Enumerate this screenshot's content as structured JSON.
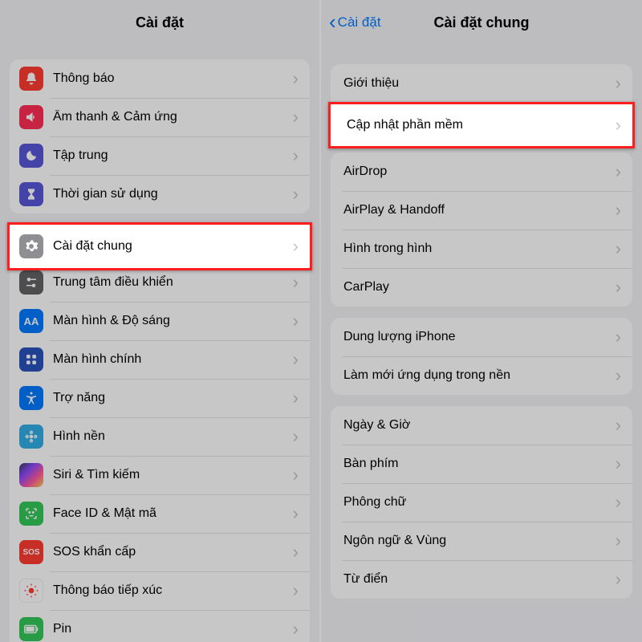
{
  "left": {
    "title": "Cài đặt",
    "groups": [
      [
        {
          "icon": "bell",
          "bg": "bg-red",
          "label": "Thông báo"
        },
        {
          "icon": "speaker",
          "bg": "bg-pink",
          "label": "Âm thanh & Cảm ứng"
        },
        {
          "icon": "moon",
          "bg": "bg-indigo",
          "label": "Tập trung"
        },
        {
          "icon": "hourglass",
          "bg": "bg-indigo",
          "label": "Thời gian sử dụng"
        }
      ],
      [
        {
          "icon": "gear",
          "bg": "bg-gray",
          "label": "Cài đặt chung",
          "highlight": true
        },
        {
          "icon": "sliders",
          "bg": "bg-darkgray",
          "label": "Trung tâm điều khiển"
        },
        {
          "icon": "aa",
          "bg": "bg-blue",
          "label": "Màn hình & Độ sáng"
        },
        {
          "icon": "grid",
          "bg": "bg-deepblue",
          "label": "Màn hình chính"
        },
        {
          "icon": "access",
          "bg": "bg-blue",
          "label": "Trợ năng"
        },
        {
          "icon": "flower",
          "bg": "bg-teal",
          "label": "Hình nền"
        },
        {
          "icon": "siri",
          "bg": "bg-black",
          "label": "Siri & Tìm kiếm"
        },
        {
          "icon": "face",
          "bg": "bg-green",
          "label": "Face ID & Mật mã"
        },
        {
          "icon": "sos",
          "bg": "bg-red",
          "label": "SOS khẩn cấp"
        },
        {
          "icon": "virus",
          "bg": "bg-white",
          "label": "Thông báo tiếp xúc"
        },
        {
          "icon": "battery",
          "bg": "bg-green",
          "label": "Pin"
        }
      ]
    ]
  },
  "right": {
    "title": "Cài đặt chung",
    "back": "Cài đặt",
    "groups": [
      [
        {
          "label": "Giới thiệu"
        },
        {
          "label": "Cập nhật phần mềm",
          "highlight": true
        }
      ],
      [
        {
          "label": "AirDrop"
        },
        {
          "label": "AirPlay & Handoff"
        },
        {
          "label": "Hình trong hình"
        },
        {
          "label": "CarPlay"
        }
      ],
      [
        {
          "label": "Dung lượng iPhone"
        },
        {
          "label": "Làm mới ứng dụng trong nền"
        }
      ],
      [
        {
          "label": "Ngày & Giờ"
        },
        {
          "label": "Bàn phím"
        },
        {
          "label": "Phông chữ"
        },
        {
          "label": "Ngôn ngữ & Vùng"
        },
        {
          "label": "Từ điển"
        }
      ]
    ]
  }
}
